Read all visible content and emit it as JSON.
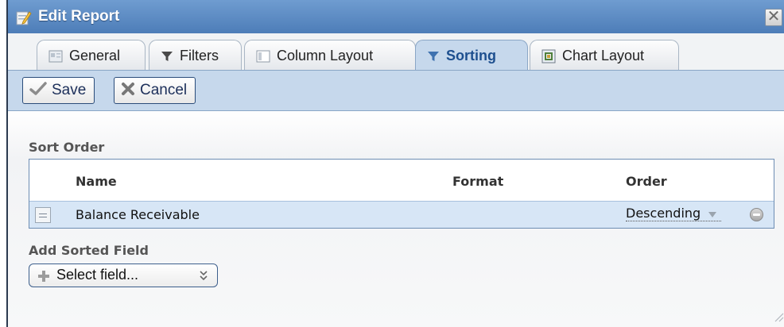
{
  "dialog": {
    "title": "Edit Report",
    "close_label": "✕"
  },
  "tabs": [
    {
      "label": "General",
      "icon": "general-icon",
      "active": false
    },
    {
      "label": "Filters",
      "icon": "filter-icon",
      "active": false
    },
    {
      "label": "Column Layout",
      "icon": "column-layout-icon",
      "active": false
    },
    {
      "label": "Sorting",
      "icon": "filter-icon",
      "active": true
    },
    {
      "label": "Chart Layout",
      "icon": "chart-icon",
      "active": false
    }
  ],
  "toolbar": {
    "save_label": "Save",
    "cancel_label": "Cancel"
  },
  "sort_order": {
    "label": "Sort Order",
    "columns": {
      "name": "Name",
      "format": "Format",
      "order": "Order"
    },
    "rows": [
      {
        "name": "Balance Receivable",
        "format": "",
        "order": "Descending"
      }
    ]
  },
  "add_sorted_field": {
    "label": "Add Sorted Field",
    "select_value": "Select field..."
  },
  "colors": {
    "titlebar": "#5b8bc5",
    "tab_active": "#c6d8ec",
    "selected_row": "#d7e6f6"
  }
}
